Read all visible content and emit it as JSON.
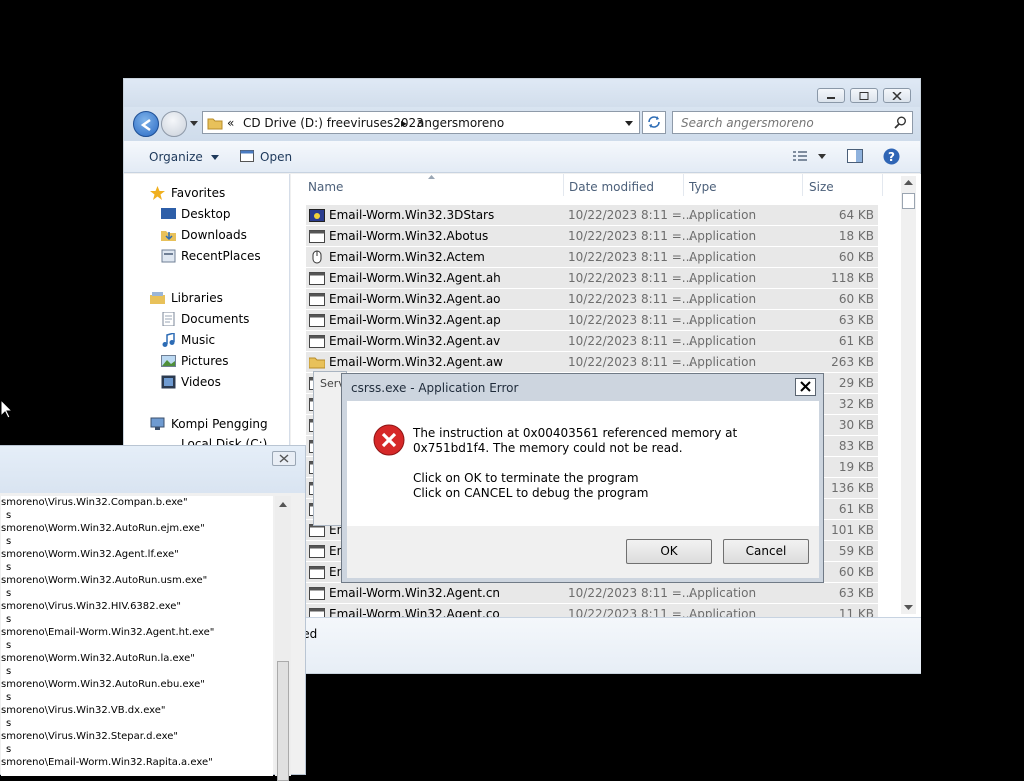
{
  "explorer": {
    "address": {
      "crumbs": [
        "«",
        "CD Drive (D:) freeviruses2023",
        "▸",
        "angersmoreno"
      ]
    },
    "search": {
      "placeholder": "Search angersmoreno"
    },
    "toolbar": {
      "organize": "Organize",
      "open": "Open"
    },
    "nav": {
      "favorites": "Favorites",
      "favorites_items": [
        "Desktop",
        "Downloads",
        "RecentPlaces"
      ],
      "libraries": "Libraries",
      "libraries_items": [
        "Documents",
        "Music",
        "Pictures",
        "Videos"
      ],
      "computer": "Kompi Pengging",
      "computer_items": [
        "Local Disk (C:)"
      ]
    },
    "columns": {
      "name": "Name",
      "date": "Date modified",
      "type": "Type",
      "size": "Size"
    },
    "files": [
      {
        "name": "Email-Worm.Win32.3DStars",
        "date": "10/22/2023 8:11 =...",
        "type": "Application",
        "size": "64 KB",
        "icon": "stars-app-icon"
      },
      {
        "name": "Email-Worm.Win32.Abotus",
        "date": "10/22/2023 8:11 =...",
        "type": "Application",
        "size": "18 KB",
        "icon": "app-window-icon"
      },
      {
        "name": "Email-Worm.Win32.Actem",
        "date": "10/22/2023 8:11 =...",
        "type": "Application",
        "size": "60 KB",
        "icon": "mouse-app-icon"
      },
      {
        "name": "Email-Worm.Win32.Agent.ah",
        "date": "10/22/2023 8:11 =...",
        "type": "Application",
        "size": "118 KB",
        "icon": "app-window-icon"
      },
      {
        "name": "Email-Worm.Win32.Agent.ao",
        "date": "10/22/2023 8:11 =...",
        "type": "Application",
        "size": "60 KB",
        "icon": "app-window-icon"
      },
      {
        "name": "Email-Worm.Win32.Agent.ap",
        "date": "10/22/2023 8:11 =...",
        "type": "Application",
        "size": "63 KB",
        "icon": "app-window-icon"
      },
      {
        "name": "Email-Worm.Win32.Agent.av",
        "date": "10/22/2023 8:11 =...",
        "type": "Application",
        "size": "61 KB",
        "icon": "app-window-icon"
      },
      {
        "name": "Email-Worm.Win32.Agent.aw",
        "date": "10/22/2023 8:11 =...",
        "type": "Application",
        "size": "263 KB",
        "icon": "folder-app-icon"
      },
      {
        "name": "Serv",
        "date": "",
        "type": "",
        "size": "29 KB",
        "icon": "app-window-icon"
      },
      {
        "name": "",
        "date": "",
        "type": "",
        "size": "32 KB",
        "icon": "app-window-icon"
      },
      {
        "name": "",
        "date": "",
        "type": "",
        "size": "30 KB",
        "icon": "app-window-icon"
      },
      {
        "name": "",
        "date": "",
        "type": "",
        "size": "83 KB",
        "icon": "app-window-icon"
      },
      {
        "name": "",
        "date": "",
        "type": "",
        "size": "19 KB",
        "icon": "app-window-icon"
      },
      {
        "name": "",
        "date": "",
        "type": "",
        "size": "136 KB",
        "icon": "app-window-icon"
      },
      {
        "name": "",
        "date": "",
        "type": "",
        "size": "61 KB",
        "icon": "app-window-icon"
      },
      {
        "name": "En",
        "date": "",
        "type": "",
        "size": "101 KB",
        "icon": "app-window-icon"
      },
      {
        "name": "En",
        "date": "",
        "type": "",
        "size": "59 KB",
        "icon": "app-window-icon"
      },
      {
        "name": "En",
        "date": "",
        "type": "",
        "size": "60 KB",
        "icon": "app-window-icon"
      },
      {
        "name": "Email-Worm.Win32.Agent.cn",
        "date": "10/22/2023 8:11 =...",
        "type": "Application",
        "size": "63 KB",
        "icon": "app-window-icon"
      },
      {
        "name": "Email-Worm.Win32.Agent.co",
        "date": "10/22/2023 8:11 =...",
        "type": "Application",
        "size": "11 KB",
        "icon": "app-window-icon"
      }
    ],
    "details_text": [
      "cted",
      "..."
    ]
  },
  "log": {
    "lines": [
      "smoreno\\Virus.Win32.Compan.b.exe\"",
      "s",
      "smoreno\\Worm.Win32.AutoRun.ejm.exe\"",
      "s",
      "smoreno\\Worm.Win32.Agent.lf.exe\"",
      "s",
      "smoreno\\Worm.Win32.AutoRun.usm.exe\"",
      "s",
      "smoreno\\Virus.Win32.HIV.6382.exe\"",
      "s",
      "smoreno\\Email-Worm.Win32.Agent.ht.exe\"",
      "s",
      "smoreno\\Worm.Win32.AutoRun.la.exe\"",
      "s",
      "smoreno\\Worm.Win32.AutoRun.ebu.exe\"",
      "s",
      "smoreno\\Virus.Win32.VB.dx.exe\"",
      "s",
      "smoreno\\Virus.Win32.Stepar.d.exe\"",
      "s",
      "smoreno\\Email-Worm.Win32.Rapita.a.exe\""
    ]
  },
  "error_dialog": {
    "title": "csrss.exe - Application Error",
    "message1": "The instruction at 0x00403561 referenced memory at 0x751bd1f4. The memory could not be read.",
    "message2": "Click on OK to terminate the program",
    "message3": "Click on CANCEL to debug the program",
    "ok": "OK",
    "cancel": "Cancel"
  },
  "colors": {
    "error_red": "#d62828",
    "selection_gray": "#e8e8e8",
    "toolbar_text": "#1e395b"
  }
}
